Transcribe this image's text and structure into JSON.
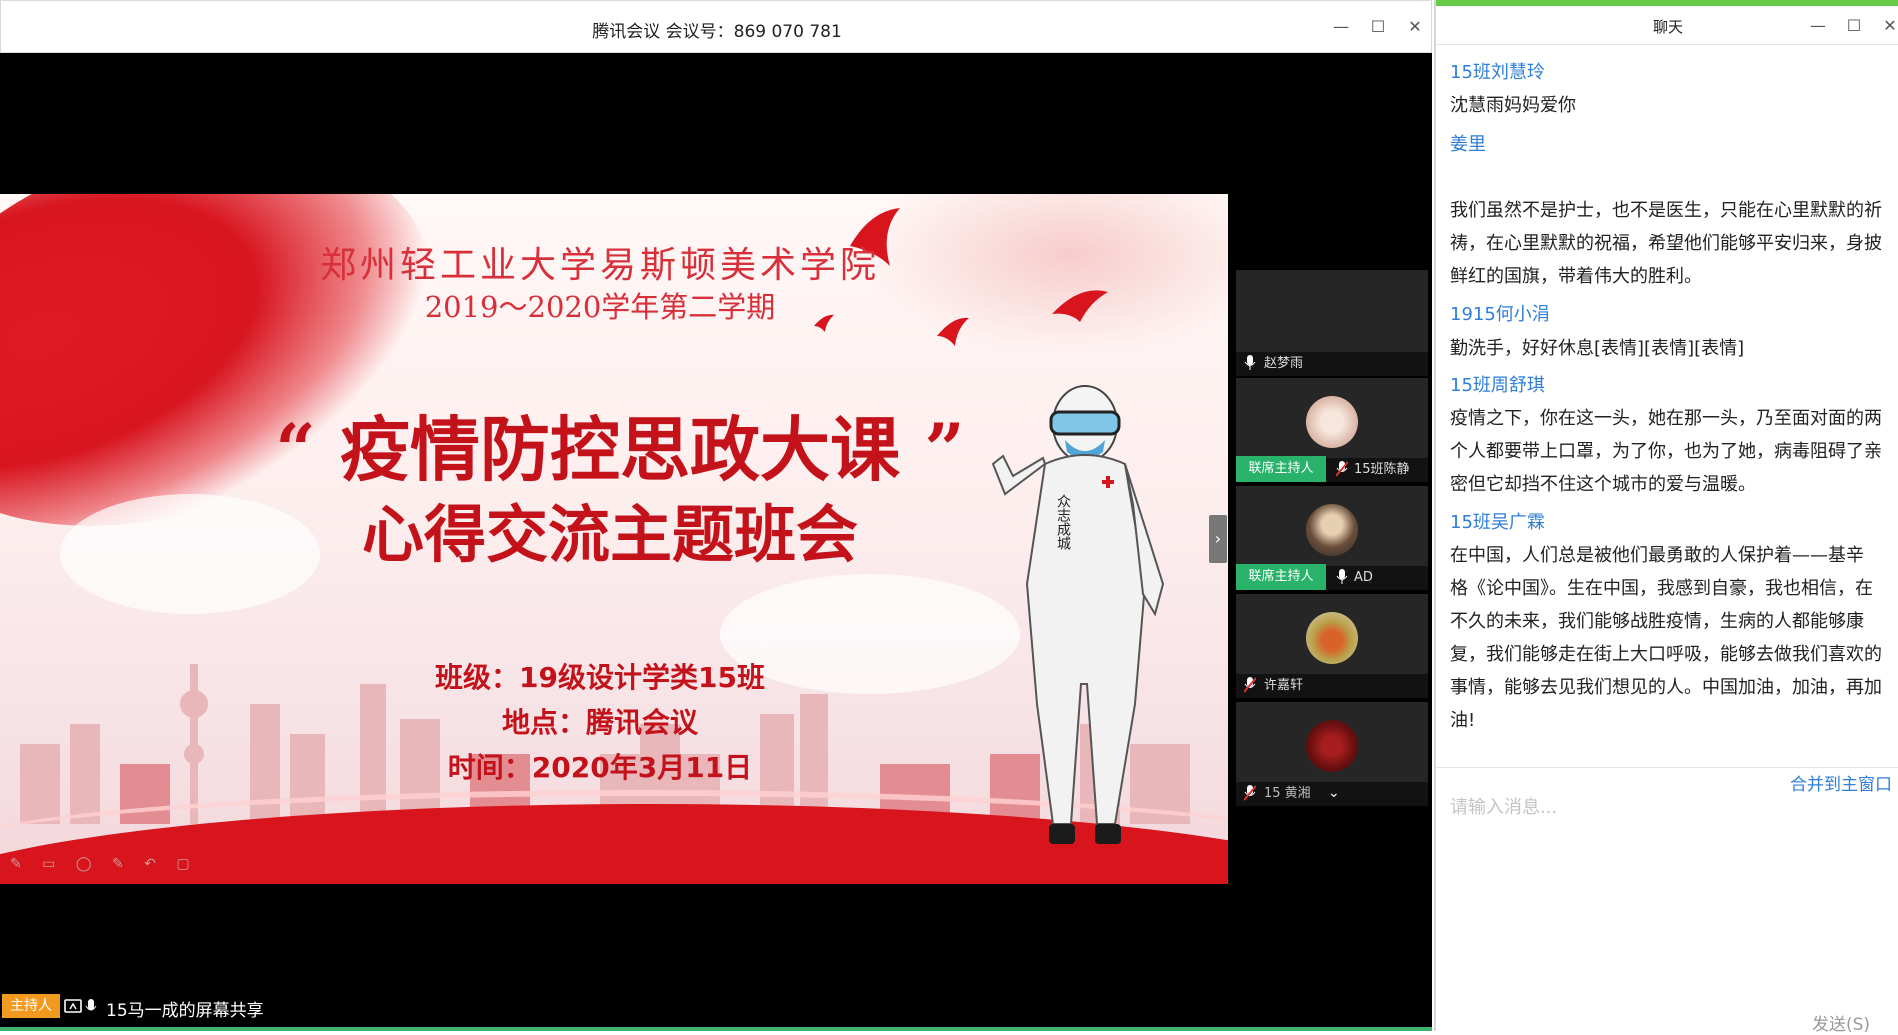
{
  "meeting": {
    "title": "腾讯会议 会议号：869 070 781",
    "window_controls": {
      "minimize": "—",
      "maximize": "☐",
      "close": "✕"
    },
    "host_tag": "主持人",
    "share_status": "15马一成的屏幕共享",
    "panel_toggle": "›"
  },
  "slide": {
    "school": "郑州轻工业大学易斯顿美术学院",
    "term": "2019～2020学年第二学期",
    "topic_line1": "“ 疫情防控思政大课 ”",
    "topic_line2": "心得交流主题班会",
    "class_info": "班级：19级设计学类15班",
    "place_info": "地点：腾讯会议",
    "time_info": "时间：2020年3月11日"
  },
  "participants": [
    {
      "name": "赵梦雨",
      "badge": "",
      "mic": "on",
      "avatar": "none"
    },
    {
      "name": "15班陈静",
      "badge": "联席主持人",
      "mic": "muted",
      "avatar": "beige-circle"
    },
    {
      "name": "AD",
      "badge": "联席主持人",
      "mic": "on",
      "avatar": "portrait"
    },
    {
      "name": "许嘉轩",
      "badge": "",
      "mic": "muted",
      "avatar": "fruit"
    },
    {
      "name": "15 黄湘",
      "badge": "",
      "mic": "muted",
      "avatar": "dark-red",
      "has_dropdown": true
    }
  ],
  "chat": {
    "title": "聊天",
    "window_controls": {
      "minimize": "—",
      "maximize": "☐",
      "close": "✕"
    },
    "messages": [
      {
        "sender": "15班刘慧玲",
        "lines": [
          "沈慧雨妈妈爱你"
        ]
      },
      {
        "sender": "姜里",
        "lines": [
          "",
          "我们虽然不是护士，也不是医生，只能在心里默默的祈",
          "祷，在心里默默的祝福，希望他们能够平安归来，身披",
          "鲜红的国旗，带着伟大的胜利。"
        ]
      },
      {
        "sender": "1915何小涓",
        "lines": [
          "勤洗手，好好休息[表情][表情][表情]"
        ]
      },
      {
        "sender": "15班周舒琪",
        "lines": [
          "疫情之下，你在这一头，她在那一头，乃至面对面的两",
          "个人都要带上口罩，为了你，也为了她，病毒阻碍了亲",
          "密但它却挡不住这个城市的爱与温暖。"
        ]
      },
      {
        "sender": "15班吴广霖",
        "lines": [
          "在中国，人们总是被他们最勇敢的人保护着——基辛",
          "格《论中国》。生在中国，我感到自豪，我也相信，在",
          "不久的未来，我们能够战胜疫情，生病的人都能够康",
          "复，我们能够走在街上大口呼吸，能够去做我们喜欢的",
          "事情，能够去见我们想见的人。中国加油，加油，再加",
          "油!"
        ]
      }
    ],
    "merge_link": "合并到主窗口",
    "input_placeholder": "请输入消息...",
    "send_label": "发送(S)"
  },
  "colors": {
    "accent_blue": "#2f7ed8",
    "host_orange": "#f19a1f",
    "cohost_green": "#29b26a",
    "slide_red": "#c4121a"
  }
}
